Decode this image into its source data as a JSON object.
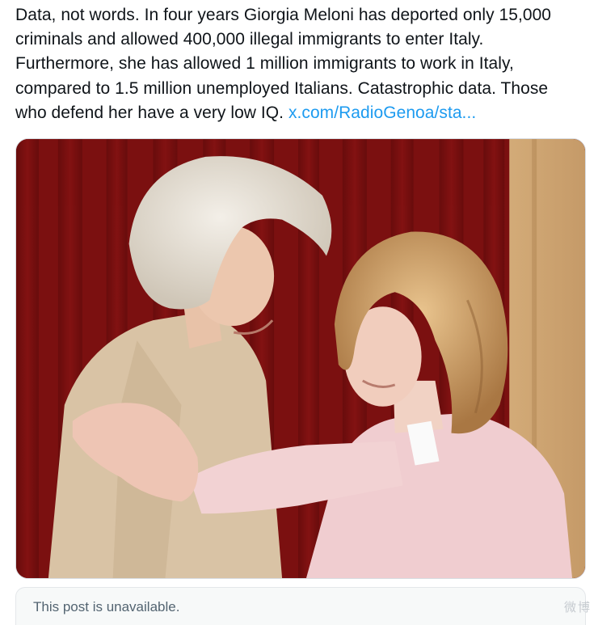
{
  "post": {
    "lines": [
      "Data, not words. In four years Giorgia Meloni has deported only 15,000",
      "criminals and allowed 400,000 illegal immigrants to enter Italy.",
      "Furthermore, she has allowed 1 million immigrants to work in Italy,",
      "compared to 1.5 million unemployed Italians. Catastrophic data. Those",
      "who defend her have a very low IQ."
    ],
    "link_text": "x.com/RadioGenoa/sta..."
  },
  "media": {
    "background_color": "#7c1010",
    "icon": "photo"
  },
  "quoted_post": {
    "unavailable_text": "This post is unavailable."
  },
  "watermark_text": "微博",
  "colors": {
    "text": "#0f1419",
    "link": "#1d9bf0",
    "muted": "#536471",
    "card_bg": "#f7f9f9"
  }
}
